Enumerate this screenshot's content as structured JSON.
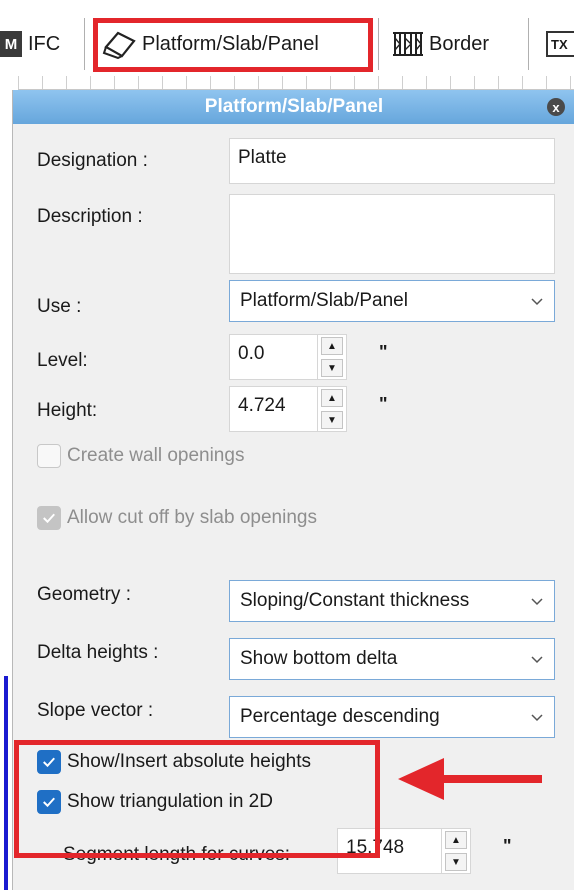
{
  "toolbar": {
    "ifc": {
      "icon_letter": "M",
      "label": "IFC"
    },
    "platform": {
      "label": "Platform/Slab/Panel"
    },
    "border": {
      "label": "Border"
    },
    "text": {
      "icon_letters": "TX"
    }
  },
  "dialog": {
    "title": "Platform/Slab/Panel",
    "close_glyph": "x",
    "designation": {
      "label": "Designation :",
      "value": "Platte"
    },
    "description": {
      "label": "Description :",
      "value": ""
    },
    "use": {
      "label": "Use :",
      "value": "Platform/Slab/Panel"
    },
    "level": {
      "label": "Level:",
      "value": "0.0",
      "unit": "\""
    },
    "height": {
      "label": "Height:",
      "value": "4.724",
      "unit": "\""
    },
    "create_wall_openings": {
      "label": "Create wall openings",
      "checked": false,
      "enabled": false
    },
    "allow_cut_off": {
      "label": "Allow cut off by slab openings",
      "checked": true,
      "enabled": false
    },
    "geometry": {
      "label": "Geometry :",
      "value": "Sloping/Constant thickness"
    },
    "delta_heights": {
      "label": "Delta heights :",
      "value": "Show bottom delta"
    },
    "slope_vector": {
      "label": "Slope vector :",
      "value": "Percentage descending"
    },
    "show_absolute_heights": {
      "label": "Show/Insert absolute heights",
      "checked": true
    },
    "show_triangulation": {
      "label": "Show triangulation in 2D",
      "checked": true
    },
    "segment_length": {
      "label": "Segment length for curves:",
      "value": "15.748",
      "unit": "\""
    }
  },
  "colors": {
    "highlight": "#e3262b",
    "title_bar": "#66a6dc",
    "checkbox_checked": "#1f6fc5"
  }
}
